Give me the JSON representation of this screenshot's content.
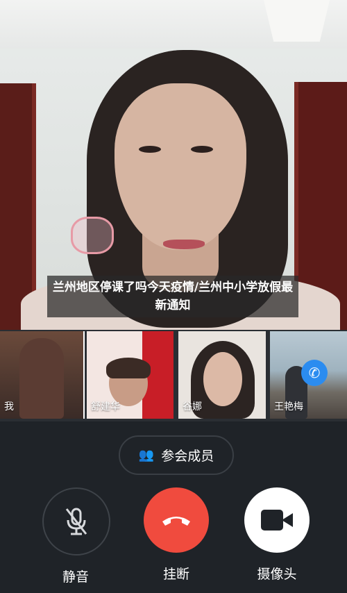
{
  "caption": "兰州地区停课了吗今天疫情/兰州中小学放假最新通知",
  "participants": [
    {
      "name": "我"
    },
    {
      "name": "舒建华"
    },
    {
      "name": "谷娜"
    },
    {
      "name": "王艳梅"
    }
  ],
  "members_button": {
    "label": "参会成员",
    "icon": "people-icon"
  },
  "controls": {
    "mute": {
      "label": "静音",
      "icon": "microphone-muted-icon"
    },
    "hangup": {
      "label": "挂断",
      "icon": "phone-hangup-icon",
      "color": "#f04b3e"
    },
    "camera": {
      "label": "摄像头",
      "icon": "video-camera-icon"
    }
  },
  "call_badge": {
    "icon": "phone-call-icon",
    "color": "#2b8cf0"
  }
}
